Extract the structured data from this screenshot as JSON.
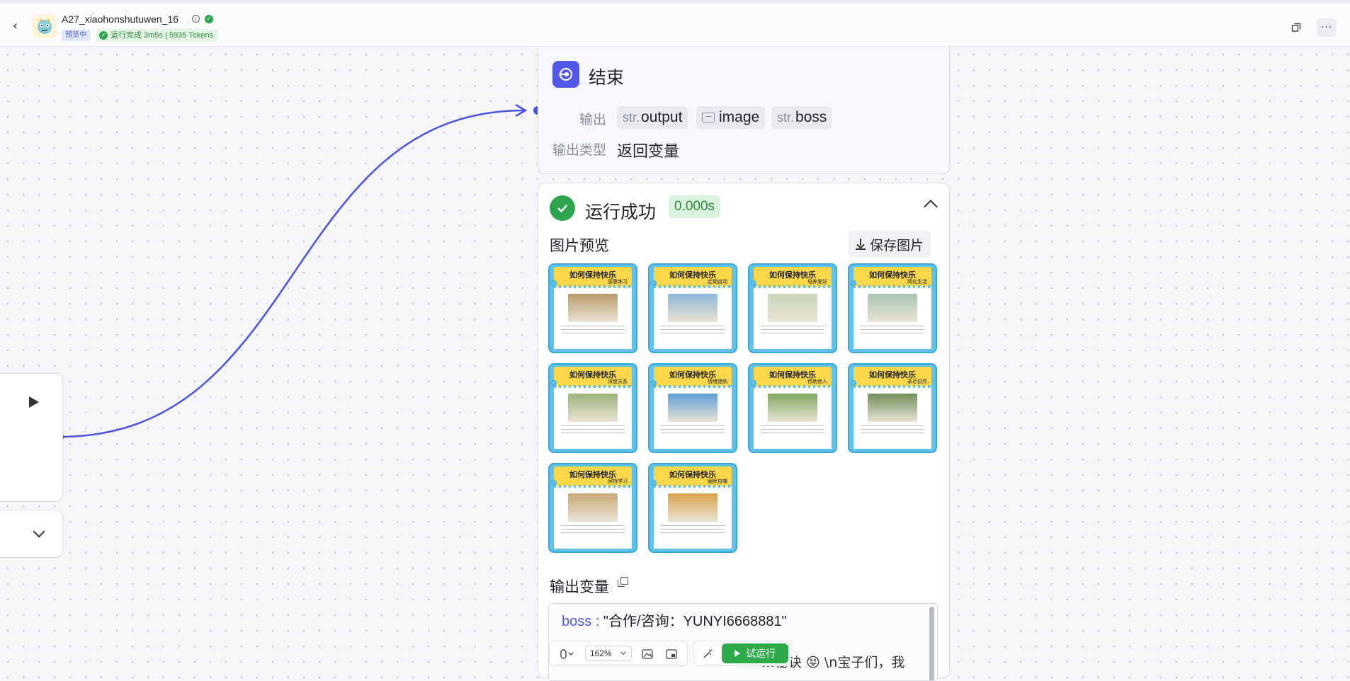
{
  "header": {
    "app_title": "A27_xiaohonshutuwen_16",
    "preview_badge": "预览中",
    "status": "运行完成 3m5s | 5935 Tokens"
  },
  "end_node": {
    "title": "结束",
    "output_label": "输出",
    "output_vars": [
      {
        "type": "str.",
        "name": "output"
      },
      {
        "type": "image-icon",
        "name": "image"
      },
      {
        "type": "str.",
        "name": "boss"
      }
    ],
    "output_type_label": "输出类型",
    "output_type_value": "返回变量"
  },
  "result": {
    "status": "运行成功",
    "duration": "0.000s",
    "preview_title": "图片预览",
    "save_button": "保存图片",
    "thumbnails": [
      {
        "title": "如何保持快乐",
        "subtitle": "感恩练习",
        "scene": "#b89a6a"
      },
      {
        "title": "如何保持快乐",
        "subtitle": "定期运动",
        "scene": "#8fb7d6"
      },
      {
        "title": "如何保持快乐",
        "subtitle": "培养爱好",
        "scene": "#c9d6b8"
      },
      {
        "title": "如何保持快乐",
        "subtitle": "简化生活",
        "scene": "#a9c4b2"
      },
      {
        "title": "如何保持快乐",
        "subtitle": "深度关系",
        "scene": "#9db37a"
      },
      {
        "title": "如何保持快乐",
        "subtitle": "情绪接纳",
        "scene": "#5f9fd6"
      },
      {
        "title": "如何保持快乐",
        "subtitle": "帮助他人",
        "scene": "#7fa860"
      },
      {
        "title": "如何保持快乐",
        "subtitle": "亲近自然",
        "scene": "#6f8f5a"
      },
      {
        "title": "如何保持快乐",
        "subtitle": "保持学习",
        "scene": "#c8a878"
      },
      {
        "title": "如何保持快乐",
        "subtitle": "幽默自嘲",
        "scene": "#d9a24e"
      }
    ],
    "output_vars_title": "输出变量",
    "output_line1_key": "boss",
    "output_line1_value": "\"合作/咨询：YUNYI6668881\"",
    "output_line3": "…秘诀 😝 \\n宝子们，我"
  },
  "toolbar": {
    "zoom": "162%",
    "run_button": "试运行"
  },
  "colors": {
    "accent": "#5257e8",
    "success": "#2ea44f",
    "run_button": "#2eaa4a"
  }
}
